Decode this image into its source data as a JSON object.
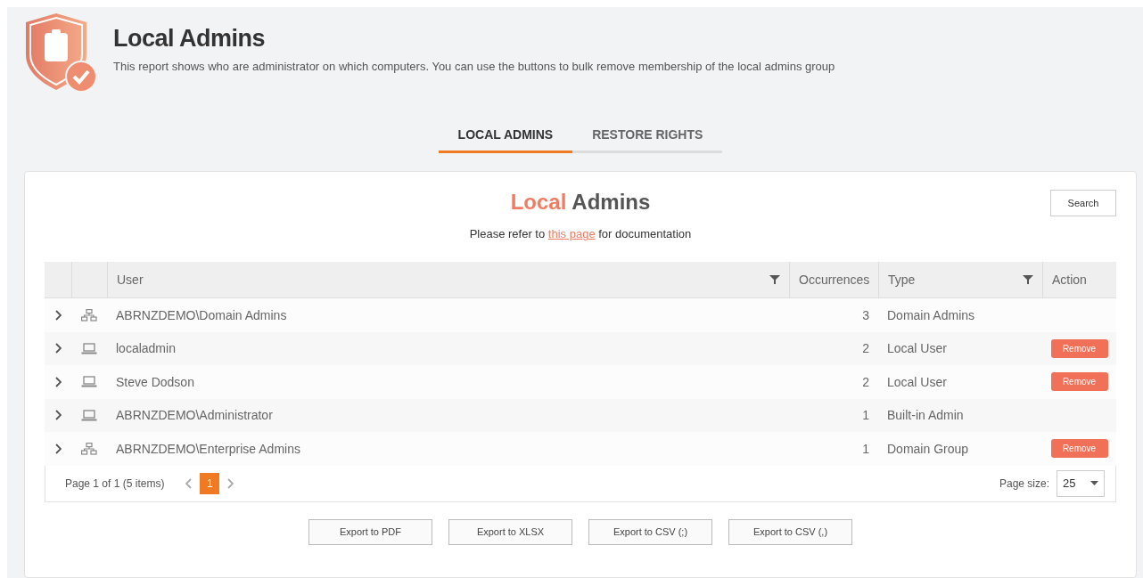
{
  "header": {
    "title": "Local Admins",
    "description": "This report shows who are administrator on which computers. You can use the buttons to bulk remove membership of the local admins group"
  },
  "tabs": [
    {
      "label": "LOCAL ADMINS",
      "selected": true
    },
    {
      "label": "RESTORE RIGHTS",
      "selected": false
    }
  ],
  "card": {
    "title_accent": "Local",
    "title_rest": "Admins",
    "search_button": "Search",
    "doc_before": "Please refer to",
    "doc_link": "this page",
    "doc_after": "for documentation"
  },
  "table": {
    "columns": [
      "User",
      "Occurrences",
      "Type",
      "Action"
    ],
    "rows": [
      {
        "kind": "group",
        "user": "ABRNZDEMO\\Domain Admins",
        "occurrences": "3",
        "type": "Domain Admins"
      },
      {
        "kind": "computer",
        "user": "localadmin",
        "occurrences": "2",
        "type": "Local User",
        "action": "Remove"
      },
      {
        "kind": "computer",
        "user": "Steve Dodson",
        "occurrences": "2",
        "type": "Local User",
        "action": "Remove"
      },
      {
        "kind": "computer",
        "user": "ABRNZDEMO\\Administrator",
        "occurrences": "1",
        "type": "Built-in Admin"
      },
      {
        "kind": "group",
        "user": "ABRNZDEMO\\Enterprise Admins",
        "occurrences": "1",
        "type": "Domain Group",
        "action": "Remove"
      }
    ]
  },
  "pager": {
    "summary": "Page 1 of 1 (5 items)",
    "pages": [
      {
        "label": "1",
        "selected": true
      }
    ],
    "page_size_label": "Page size:",
    "page_size": "25"
  },
  "exports": [
    "Export to PDF",
    "Export to XLSX",
    "Export to CSV (;)",
    "Export to CSV (,)"
  ]
}
